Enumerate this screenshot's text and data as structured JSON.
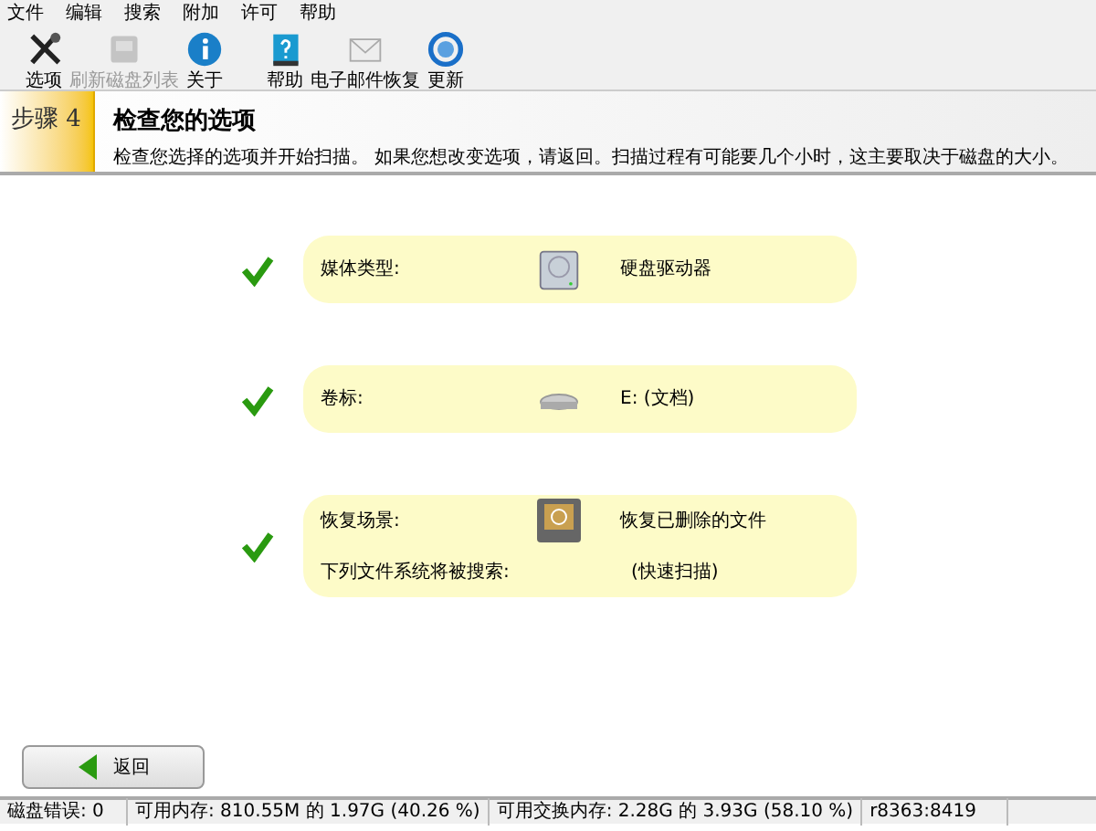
{
  "menu": [
    "文件",
    "编辑",
    "搜索",
    "附加",
    "许可",
    "帮助"
  ],
  "toolbar": [
    {
      "kind": "tools",
      "label": "选项",
      "disabled": false
    },
    {
      "kind": "drive",
      "label": "刷新磁盘列表",
      "disabled": true
    },
    {
      "kind": "info",
      "label": "关于",
      "disabled": false
    },
    {
      "kind": "help",
      "label": "帮助",
      "disabled": false
    },
    {
      "kind": "mail",
      "label": "电子邮件恢复",
      "disabled": false
    },
    {
      "kind": "update",
      "label": "更新",
      "disabled": false
    }
  ],
  "step": {
    "label": "步骤 4",
    "title": "检查您的选项",
    "description": "检查您选择的选项并开始扫描。 如果您想改变选项，请返回。扫描过程有可能要几个小时，这主要取决于磁盘的大小。"
  },
  "options": [
    {
      "kind": "hdd",
      "checked": true,
      "lines": [
        {
          "label": "媒体类型:",
          "value": "硬盘驱动器"
        }
      ]
    },
    {
      "kind": "volume",
      "checked": true,
      "lines": [
        {
          "label": "卷标:",
          "value": "E: (文档)"
        }
      ]
    },
    {
      "kind": "recycle",
      "checked": true,
      "lines": [
        {
          "label": "恢复场景:",
          "value": "恢复已删除的文件"
        },
        {
          "label": "下列文件系统将被搜索:",
          "value": "(快速扫描)"
        }
      ]
    }
  ],
  "back_button": "返回",
  "status_bar": [
    "磁盘错误: 0",
    "可用内存: 810.55M 的 1.97G (40.26 %)",
    "可用交换内存: 2.28G 的 3.93G (58.10 %)",
    "r8363:8419"
  ]
}
